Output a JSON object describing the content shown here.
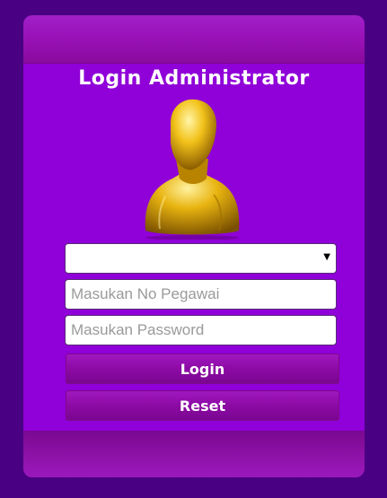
{
  "form": {
    "title": "Login Administrator",
    "level_select": {
      "value": ""
    },
    "employee_id": {
      "placeholder": "Masukan No Pegawai",
      "value": ""
    },
    "password": {
      "placeholder": "Masukan Password",
      "value": ""
    },
    "login_label": "Login",
    "reset_label": "Reset"
  },
  "icons": {
    "avatar": "user-bust-icon",
    "dropdown": "chevron-down-icon"
  },
  "colors": {
    "background": "#4a0082",
    "panel": "#9000d8",
    "button": "#8c0aa4",
    "avatar_gold": "#e6b800"
  }
}
